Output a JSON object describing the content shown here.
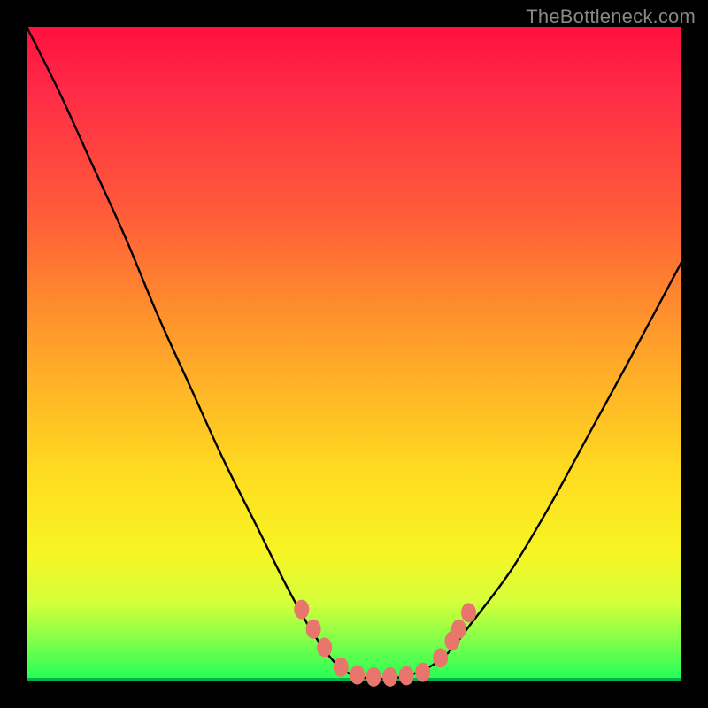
{
  "watermark": "TheBottleneck.com",
  "colors": {
    "frame": "#000000",
    "marker": "#e9766c",
    "curve": "#000000",
    "gradient_top": "#ff1040",
    "gradient_bottom": "#1dff58"
  },
  "chart_data": {
    "type": "line",
    "title": "",
    "xlabel": "",
    "ylabel": "",
    "xlim": [
      0,
      100
    ],
    "ylim": [
      0,
      100
    ],
    "note": "No numeric axes shown. X and Y are normalized 0–100 of plot area. Y=100 corresponds to top (red / high bottleneck), Y=0 bottom (green / no bottleneck). Curve is a V-shape dipping to ~0 around x≈48–62.",
    "series": [
      {
        "name": "bottleneck-curve",
        "x": [
          0,
          5,
          10,
          15,
          20,
          25,
          30,
          35,
          40,
          44,
          48,
          52,
          56,
          60,
          64,
          68,
          74,
          80,
          86,
          92,
          100
        ],
        "values": [
          100,
          90,
          79,
          68,
          56,
          45,
          34,
          24,
          14,
          7,
          2,
          0.5,
          0.5,
          1.5,
          4,
          9,
          17,
          27,
          38,
          49,
          64
        ]
      }
    ],
    "markers": {
      "name": "highlighted-points",
      "note": "pink dots near the valley, approximate positions in same 0–100 space",
      "points": [
        {
          "x": 42.0,
          "y": 11.0
        },
        {
          "x": 43.8,
          "y": 8.0
        },
        {
          "x": 45.5,
          "y": 5.2
        },
        {
          "x": 48.0,
          "y": 2.2
        },
        {
          "x": 50.5,
          "y": 1.0
        },
        {
          "x": 53.0,
          "y": 0.7
        },
        {
          "x": 55.5,
          "y": 0.7
        },
        {
          "x": 58.0,
          "y": 0.9
        },
        {
          "x": 60.5,
          "y": 1.4
        },
        {
          "x": 63.2,
          "y": 3.6
        },
        {
          "x": 65.0,
          "y": 6.2
        },
        {
          "x": 66.0,
          "y": 8.0
        },
        {
          "x": 67.5,
          "y": 10.5
        }
      ]
    }
  }
}
